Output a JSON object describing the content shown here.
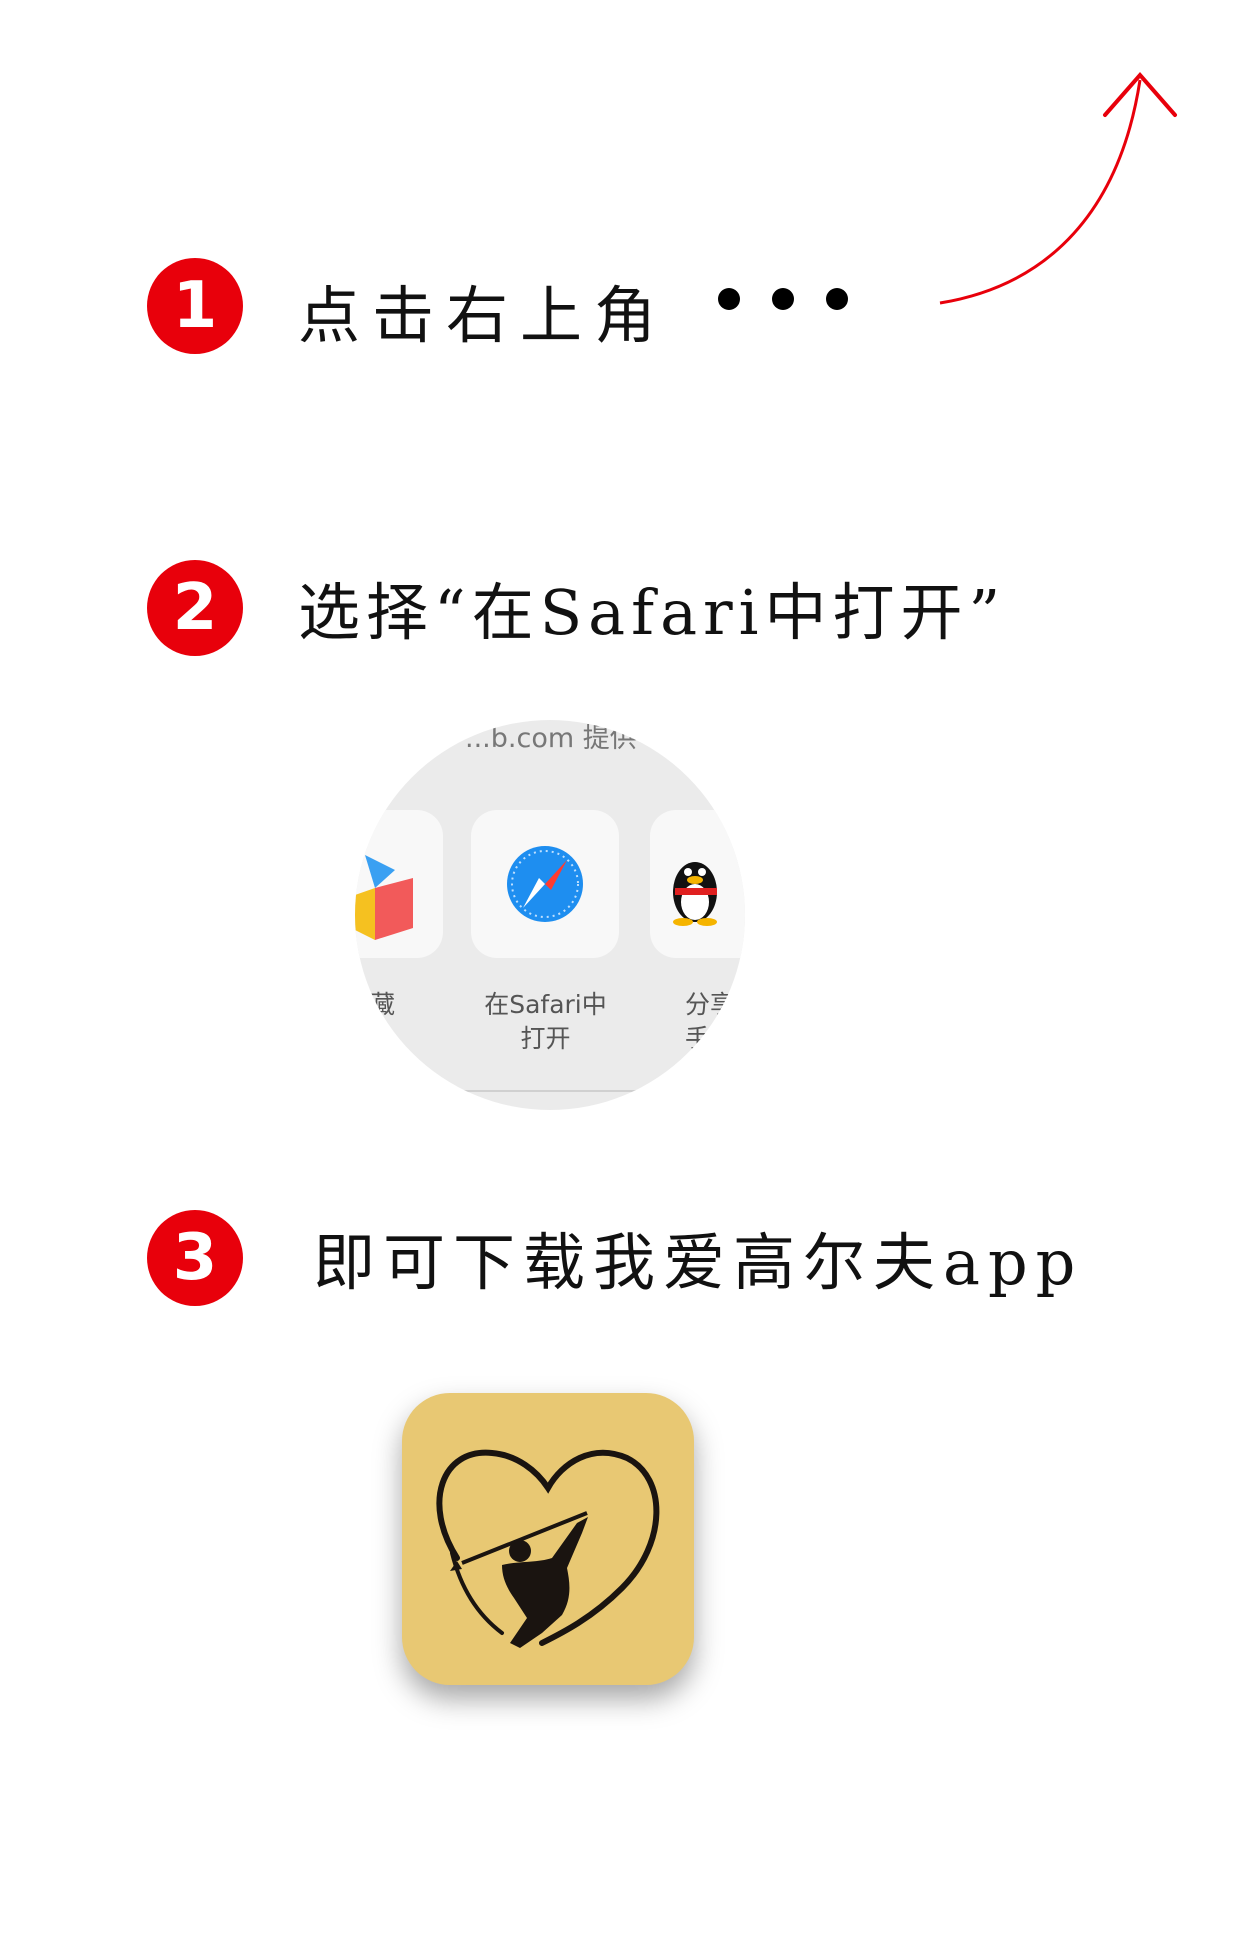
{
  "steps": [
    {
      "number": "1",
      "text": "点击右上角"
    },
    {
      "number": "2",
      "text": "选择“在Safari中打开”"
    },
    {
      "number": "3",
      "text": "即可下载我爱高尔夫app"
    }
  ],
  "share_sheet": {
    "url_fragment": "...b.com 提供",
    "left_label": "藏",
    "safari_label_line1": "在Safari中",
    "safari_label_line2": "打开",
    "right_label_line1": "分享",
    "right_label_line2": "手"
  },
  "colors": {
    "accent_red": "#e8000b",
    "app_icon_bg": "#e8c873"
  },
  "icons": [
    "more-dots-icon",
    "curved-arrow-icon",
    "safari-compass-icon",
    "qq-penguin-icon",
    "golf-heart-app-icon"
  ]
}
